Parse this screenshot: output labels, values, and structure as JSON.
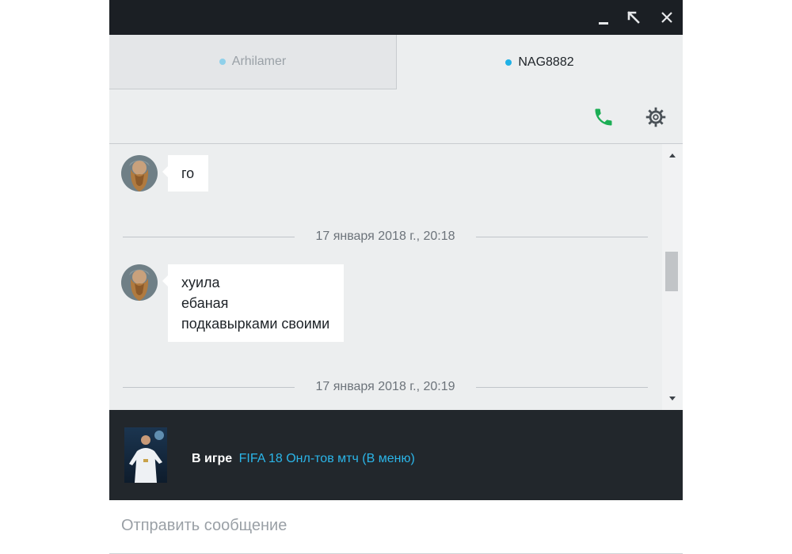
{
  "window": {
    "controls": [
      "minimize-icon",
      "restore-icon",
      "close-icon"
    ]
  },
  "tabs": [
    {
      "label": "Arhilamer",
      "active": false,
      "status_color": "#8fd0ea"
    },
    {
      "label": "NAG8882",
      "active": true,
      "status_color": "#1fb1e6"
    }
  ],
  "toolbar": {
    "icons": [
      "phone-icon",
      "settings-gear-icon"
    ],
    "phone_color": "#1cae55"
  },
  "messages": [
    {
      "lines": [
        "го"
      ]
    },
    {
      "lines": [
        "хуила",
        "ебаная",
        "подкавырками своими"
      ]
    }
  ],
  "separators": [
    {
      "date": "17 января 2018 г., 20:18"
    },
    {
      "date": "17 января 2018 г., 20:19"
    }
  ],
  "status": {
    "prefix": "В игре",
    "game": "FIFA 18 Онл-тов мтч (В меню)"
  },
  "input": {
    "placeholder": "Отправить сообщение"
  },
  "colors": {
    "accent": "#1fb1e6",
    "titlebar": "#1b1f24",
    "status_bar": "#22272c"
  }
}
